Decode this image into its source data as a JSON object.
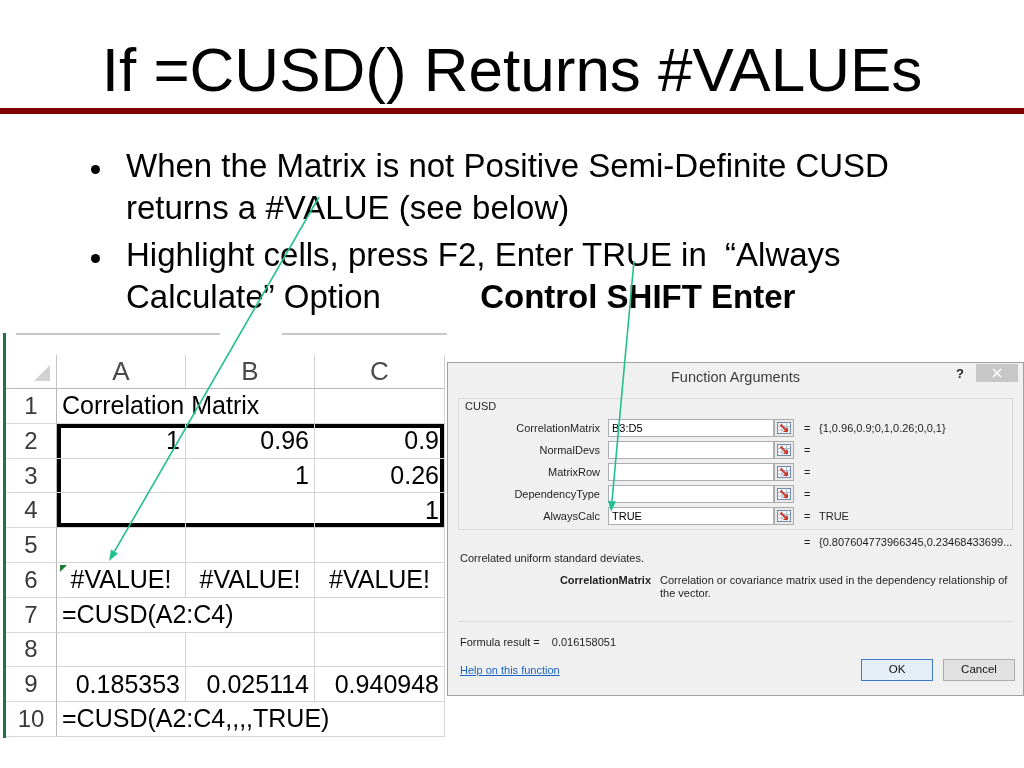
{
  "slide": {
    "title": "If =CUSD() Returns #VALUEs",
    "bullets": [
      {
        "text": "When the Matrix is not Positive Semi-Definite CUSD returns a #VALUE (see below)"
      },
      {
        "text": "Highlight cells, press F2, Enter TRUE in  “Always Calculate” Option",
        "emphasis": "Control SHIFT Enter"
      }
    ]
  },
  "spreadsheet": {
    "columns": [
      "A",
      "B",
      "C"
    ],
    "rows": [
      {
        "header": "1",
        "boxed": false,
        "cells": [
          {
            "text": "Correlation Matrix",
            "kind": "text",
            "flagged": false
          },
          null,
          null
        ]
      },
      {
        "header": "2",
        "boxed": true,
        "cells": [
          {
            "text": "1",
            "kind": "number",
            "flagged": false
          },
          {
            "text": "0.96",
            "kind": "number",
            "flagged": false
          },
          {
            "text": "0.9",
            "kind": "number",
            "flagged": false
          }
        ]
      },
      {
        "header": "3",
        "boxed": true,
        "cells": [
          null,
          {
            "text": "1",
            "kind": "number",
            "flagged": false
          },
          {
            "text": "0.26",
            "kind": "number",
            "flagged": false
          }
        ]
      },
      {
        "header": "4",
        "boxed": true,
        "cells": [
          null,
          null,
          {
            "text": "1",
            "kind": "number",
            "flagged": false
          }
        ]
      },
      {
        "header": "5",
        "boxed": false,
        "cells": [
          null,
          null,
          null
        ]
      },
      {
        "header": "6",
        "boxed": false,
        "cells": [
          {
            "text": "#VALUE!",
            "kind": "error",
            "flagged": true
          },
          {
            "text": "#VALUE!",
            "kind": "error",
            "flagged": false
          },
          {
            "text": "#VALUE!",
            "kind": "error",
            "flagged": false
          }
        ]
      },
      {
        "header": "7",
        "boxed": false,
        "cells": [
          {
            "text": "=CUSD(A2:C4)",
            "kind": "text",
            "flagged": false
          },
          null,
          null
        ]
      },
      {
        "header": "8",
        "boxed": false,
        "cells": [
          null,
          null,
          null
        ]
      },
      {
        "header": "9",
        "boxed": false,
        "cells": [
          {
            "text": "0.185353",
            "kind": "number",
            "flagged": false
          },
          {
            "text": "0.025114",
            "kind": "number",
            "flagged": false
          },
          {
            "text": "0.940948",
            "kind": "number",
            "flagged": false
          }
        ]
      },
      {
        "header": "10",
        "boxed": false,
        "cells": [
          {
            "text": "=CUSD(A2:C4,,,,TRUE)",
            "kind": "text",
            "flagged": false
          },
          null,
          null
        ]
      }
    ]
  },
  "dialog": {
    "title": "Function Arguments",
    "help": "?",
    "function_name": "CUSD",
    "arguments": [
      {
        "label": "CorrelationMatrix",
        "value": "B3:D5",
        "sign": "=",
        "result": "{1,0.96,0.9;0,1,0.26;0,0,1}"
      },
      {
        "label": "NormalDevs",
        "sign": "="
      },
      {
        "label": "MatrixRow",
        "sign": "="
      },
      {
        "label": "DependencyType",
        "sign": "="
      },
      {
        "label": "AlwaysCalc",
        "value": "TRUE",
        "sign": "=",
        "result": "TRUE"
      }
    ],
    "result": {
      "sign": "=",
      "value": "{0.807604773966345,0.23468433699..."
    },
    "description": "Correlated uniform standard deviates.",
    "argument_help": {
      "name": "CorrelationMatrix",
      "text": "Correlation or covariance matrix used in the dependency relationship of the vector."
    },
    "formula_result": {
      "label": "Formula result =",
      "value": "0.016158051"
    },
    "help_link": "Help on this function",
    "buttons": [
      {
        "label": "OK",
        "default": true
      },
      {
        "label": "Cancel",
        "default": false
      }
    ]
  }
}
